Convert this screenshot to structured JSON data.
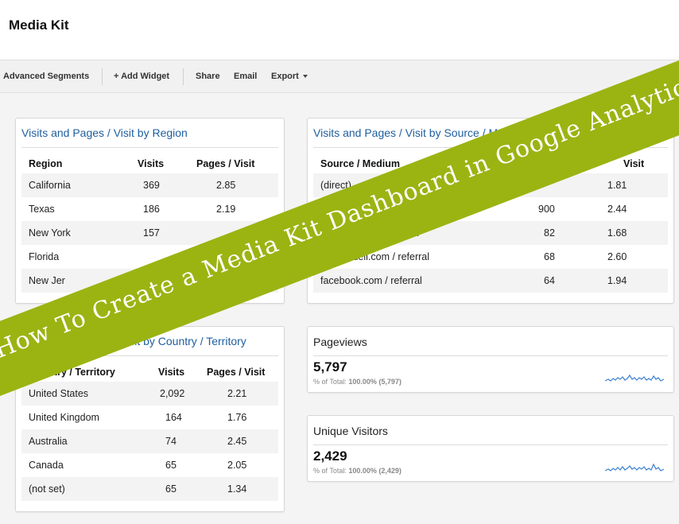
{
  "page": {
    "title": "Media Kit"
  },
  "toolbar": {
    "advanced_segments": "Advanced Segments",
    "add_widget": "+ Add Widget",
    "share": "Share",
    "email": "Email",
    "export": "Export"
  },
  "widgets": {
    "region": {
      "title": "Visits and Pages / Visit by Region",
      "headers": [
        "Region",
        "Visits",
        "Pages / Visit"
      ],
      "rows": [
        [
          "California",
          "369",
          "2.85"
        ],
        [
          "Texas",
          "186",
          "2.19"
        ],
        [
          "New York",
          "157",
          ""
        ],
        [
          "Florida",
          "",
          ""
        ],
        [
          "New Jer",
          "",
          ""
        ]
      ]
    },
    "source": {
      "title": "Visits and Pages / Visit by Source / M",
      "headers": [
        "Source / Medium",
        "",
        "Visit"
      ],
      "rows": [
        [
          "(direct)",
          "",
          "1.81"
        ],
        [
          "",
          "900",
          "2.44"
        ],
        [
          "rral",
          "82",
          "1.68"
        ],
        [
          "ssadell.com / referral",
          "68",
          "2.60"
        ],
        [
          "facebook.com / referral",
          "64",
          "1.94"
        ]
      ]
    },
    "country": {
      "title": "ages / Visit by Country / Territory",
      "headers": [
        "Country / Territory",
        "Visits",
        "Pages / Visit"
      ],
      "rows": [
        [
          "United States",
          "2,092",
          "2.21"
        ],
        [
          "United Kingdom",
          "164",
          "1.76"
        ],
        [
          "Australia",
          "74",
          "2.45"
        ],
        [
          "Canada",
          "65",
          "2.05"
        ],
        [
          "(not set)",
          "65",
          "1.34"
        ]
      ]
    },
    "pageviews": {
      "title": "Pageviews",
      "value": "5,797",
      "sub_label": "% of Total:",
      "sub_value": "100.00% (5,797)"
    },
    "unique_visitors": {
      "title": "Unique Visitors",
      "value": "2,429",
      "sub_label": "% of Total:",
      "sub_value": "100.00% (2,429)"
    }
  },
  "banner": {
    "text": "How To Create a Media Kit Dashboard in Google Analytics"
  },
  "colors": {
    "title_link": "#1f5fa0",
    "banner": "#9bb412",
    "sparkline": "#3a7fd0"
  }
}
